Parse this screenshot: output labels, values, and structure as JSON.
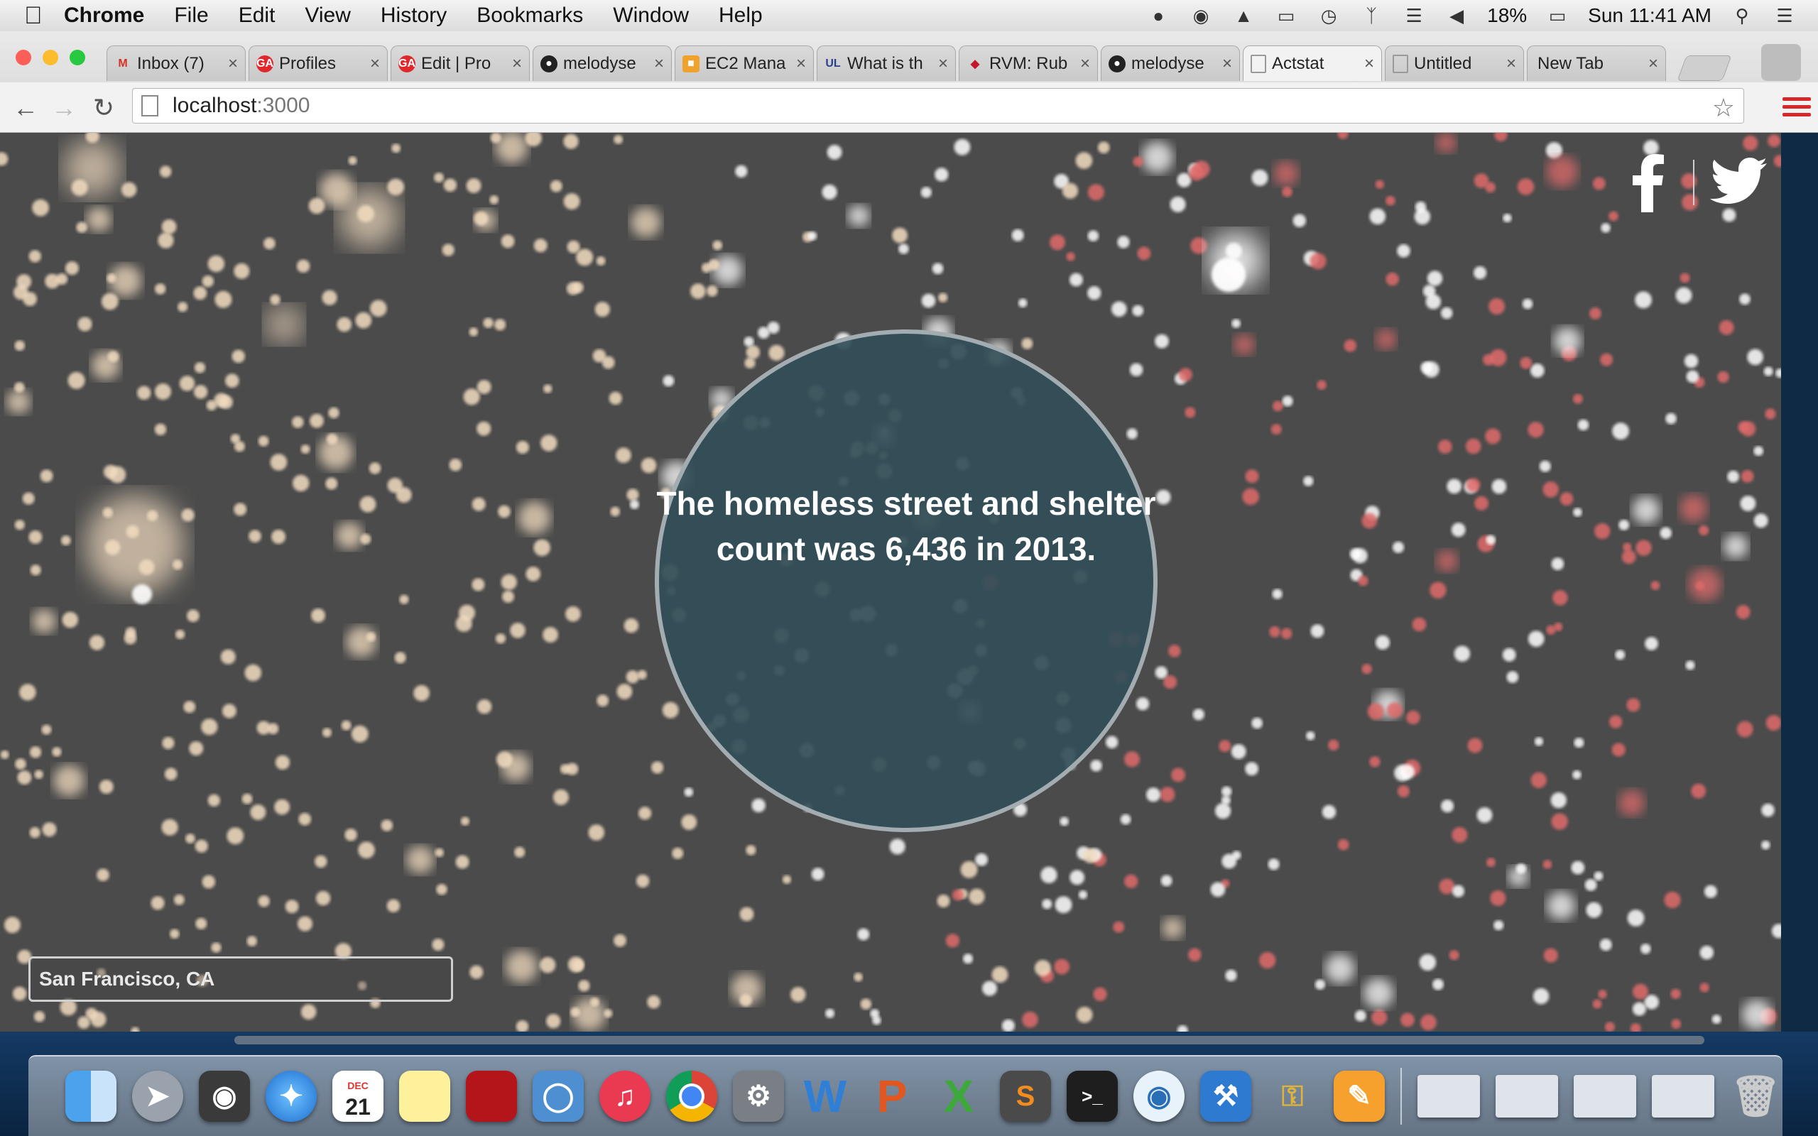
{
  "menubar": {
    "app": "Chrome",
    "items": [
      "File",
      "Edit",
      "View",
      "History",
      "Bookmarks",
      "Window",
      "Help"
    ],
    "battery": "18%",
    "clock": "Sun 11:41 AM"
  },
  "tabs": [
    {
      "label": "Inbox (7)",
      "favicon": "gmail-icon"
    },
    {
      "label": "Profiles",
      "favicon": "ga-icon"
    },
    {
      "label": "Edit | Pro",
      "favicon": "ga-icon"
    },
    {
      "label": "melodyse",
      "favicon": "github-icon"
    },
    {
      "label": "EC2 Mana",
      "favicon": "aws-box-icon"
    },
    {
      "label": "What is th",
      "favicon": "ul-icon"
    },
    {
      "label": "RVM: Rub",
      "favicon": "ruby-icon"
    },
    {
      "label": "melodyse",
      "favicon": "github-icon"
    },
    {
      "label": "Actstat",
      "favicon": "page-icon",
      "active": true
    },
    {
      "label": "Untitled",
      "favicon": "page-icon"
    },
    {
      "label": "New Tab",
      "favicon": ""
    }
  ],
  "address": {
    "host": "localhost",
    "port": ":3000"
  },
  "page": {
    "headline": "The homeless street and shelter count was 6,436 in 2013.",
    "location_value": "San Francisco, CA",
    "colors": {
      "background": "#4b4b4b",
      "bubble": "#324e58",
      "beige_dots": "#f2dcc0",
      "white_dots": "#ffffff",
      "red_dots": "#e06a6a"
    }
  },
  "dock": {
    "apps": [
      "Finder",
      "Launchpad",
      "FaceTime",
      "Safari",
      "Calendar",
      "Stickies",
      "Photo Booth",
      "iPhoto",
      "iTunes",
      "Google Chrome",
      "System Preferences",
      "Word",
      "PowerPoint",
      "Excel",
      "Sublime Text",
      "Terminal",
      "Messages",
      "Xcode",
      "Keychain Access",
      "Pages"
    ],
    "calendar_month": "DEC",
    "calendar_day": "21"
  }
}
